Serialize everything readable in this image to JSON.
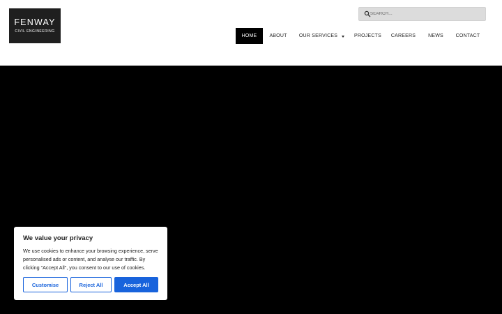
{
  "logo": {
    "name": "FENWAY",
    "tagline": "CIVIL ENGINEERING"
  },
  "search": {
    "placeholder": "SEARCH...",
    "value": "",
    "icon": "search-icon"
  },
  "nav": {
    "items": [
      {
        "label": "HOME",
        "active": true
      },
      {
        "label": "ABOUT"
      },
      {
        "label": "OUR SERVICES",
        "has_dropdown": true
      },
      {
        "label": "PROJECTS"
      },
      {
        "label": "CAREERS"
      },
      {
        "label": "NEWS"
      },
      {
        "label": "CONTACT"
      }
    ]
  },
  "cookie_banner": {
    "title": "We value your privacy",
    "text": "We use cookies to enhance your browsing experience, serve personalised ads or content, and analyse our traffic. By clicking \"Accept All\", you consent to our use of cookies.",
    "customise_label": "Customise",
    "reject_label": "Reject All",
    "accept_label": "Accept All"
  },
  "colors": {
    "accent": "#1863dc",
    "hero_background": "#000000",
    "nav_active": "#000000",
    "logo_background": "#1f1f1f",
    "search_background": "#dcdcdc"
  }
}
